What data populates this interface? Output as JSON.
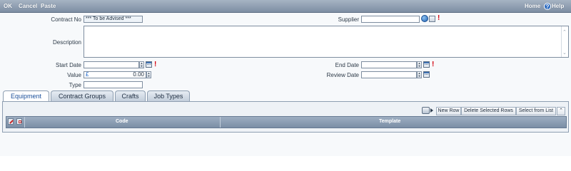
{
  "toolbar": {
    "ok_label": "OK",
    "cancel_label": "Cancel",
    "paste_label": "Paste",
    "home_label": "Home",
    "help_label": "Help"
  },
  "form": {
    "contract_no": {
      "label": "Contract No",
      "value": "*** To be Advised ***"
    },
    "supplier": {
      "label": "Supplier",
      "value": ""
    },
    "description": {
      "label": "Description",
      "value": ""
    },
    "start_date": {
      "label": "Start Date",
      "value": ""
    },
    "end_date": {
      "label": "End Date",
      "value": ""
    },
    "value": {
      "label": "Value",
      "currency": "£",
      "amount": "0.00"
    },
    "review_date": {
      "label": "Review Date",
      "value": ""
    },
    "type": {
      "label": "Type",
      "value": ""
    },
    "required_mark": "!"
  },
  "tabs": [
    {
      "label": "Equipment",
      "active": true
    },
    {
      "label": "Contract Groups",
      "active": false
    },
    {
      "label": "Crafts",
      "active": false
    },
    {
      "label": "Job Types",
      "active": false
    }
  ],
  "actions": {
    "new_row": "New Row",
    "delete_selected": "Delete Selected Rows",
    "select_from_list": "Select from List"
  },
  "grid": {
    "columns": [
      "Code",
      "Template"
    ]
  },
  "colors": {
    "toolbar": "#7d8ea3",
    "required": "#d4000d",
    "grid_header": "#8a9db3",
    "active_tab_text": "#1a4f9a"
  },
  "icons": [
    "help-icon",
    "search-icon",
    "lookup-icon",
    "calendar-icon",
    "spinner-icon",
    "export-icon",
    "collapse-icon",
    "grid-edit-icon",
    "grid-delete-icon"
  ]
}
